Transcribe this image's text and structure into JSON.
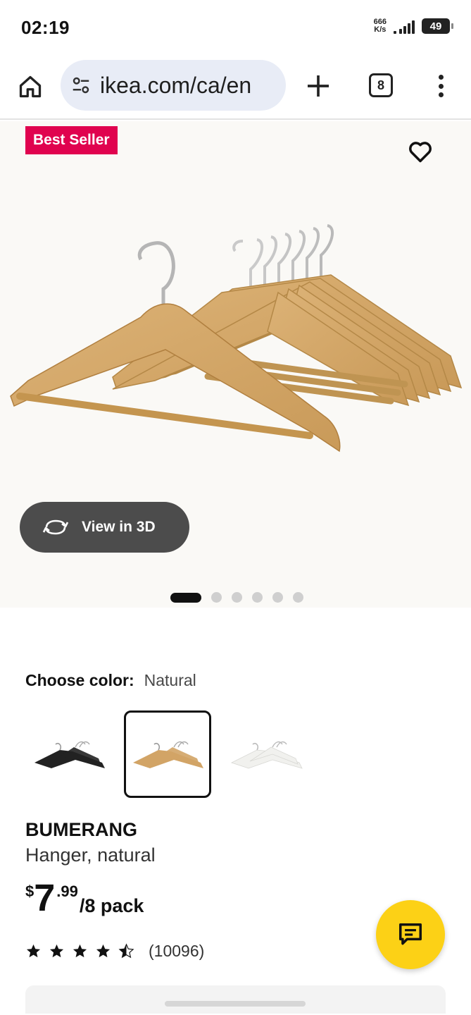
{
  "status_bar": {
    "time": "02:19",
    "net_speed_value": "666",
    "net_speed_unit": "K/s",
    "battery": "49"
  },
  "browser": {
    "url": "ikea.com/ca/en",
    "tab_count": "8",
    "icons": [
      "home-icon",
      "site-settings-icon",
      "new-tab-plus-icon",
      "tab-switcher-icon",
      "more-menu-icon"
    ]
  },
  "product_image": {
    "badge": "Best Seller",
    "view_3d_label": "View in 3D",
    "carousel_total": 6,
    "carousel_active": 1
  },
  "color": {
    "label": "Choose color:",
    "value": "Natural",
    "options": [
      "black",
      "natural",
      "white"
    ],
    "selected": "natural"
  },
  "product": {
    "name": "BUMERANG",
    "description": "Hanger, natural",
    "price_currency": "$",
    "price_whole": "7",
    "price_cents": ".99",
    "price_unit": "/8 pack",
    "rating": 4.5,
    "review_count": "(10096)"
  },
  "colors": {
    "badge": "#e0034f",
    "chat_fab": "#fcd116",
    "view3d_bg": "#4c4c4c",
    "url_pill": "#e8ecf6"
  }
}
